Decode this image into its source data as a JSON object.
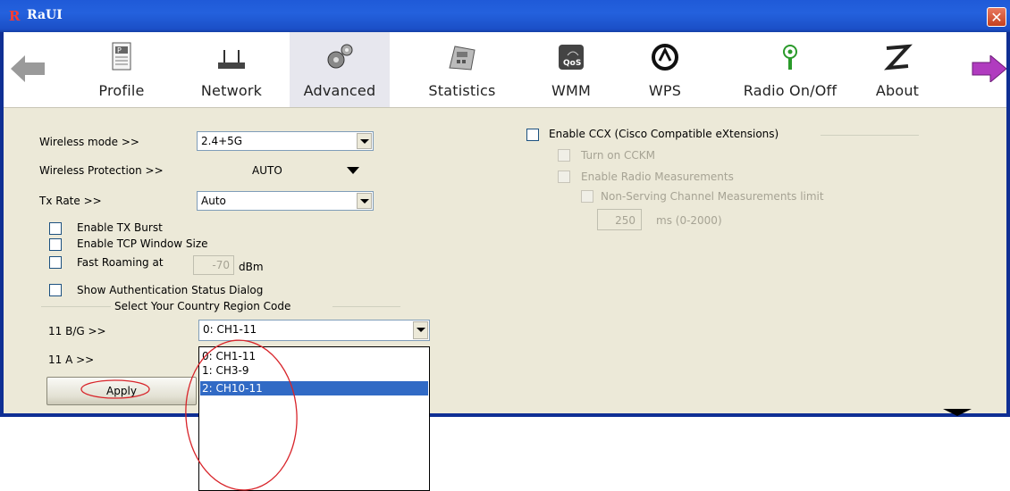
{
  "window": {
    "title": "RaUI",
    "logo": "R"
  },
  "toolbar": {
    "items": [
      {
        "label": "Profile",
        "icon": "profile-icon"
      },
      {
        "label": "Network",
        "icon": "network-icon"
      },
      {
        "label": "Advanced",
        "icon": "advanced-gears-icon"
      },
      {
        "label": "Statistics",
        "icon": "statistics-icon"
      },
      {
        "label": "WMM",
        "icon": "wmm-qos-icon"
      },
      {
        "label": "WPS",
        "icon": "wps-icon"
      },
      {
        "label": "Radio On/Off",
        "icon": "radio-antenna-icon"
      },
      {
        "label": "About",
        "icon": "about-icon"
      }
    ],
    "selected": "Advanced"
  },
  "settings": {
    "wireless_mode_label": "Wireless mode >>",
    "wireless_mode_value": "2.4+5G",
    "wireless_protection_label": "Wireless Protection >>",
    "wireless_protection_value": "AUTO",
    "tx_rate_label": "Tx Rate >>",
    "tx_rate_value": "Auto",
    "enable_tx_burst": "Enable TX Burst",
    "enable_tcp_window": "Enable TCP Window Size",
    "fast_roaming": "Fast Roaming at",
    "fast_roaming_value": "-70",
    "fast_roaming_unit": "dBm",
    "show_auth": "Show Authentication Status Dialog",
    "country_group": "Select Your Country Region Code",
    "bg_label": "11 B/G >>",
    "bg_value": "0: CH1-11",
    "a_label": "11 A >>",
    "apply": "Apply"
  },
  "ccx": {
    "enable": "Enable CCX (Cisco Compatible eXtensions)",
    "turn_on_cckm": "Turn on CCKM",
    "enable_radio_meas": "Enable Radio Measurements",
    "non_serving": "Non-Serving Channel Measurements limit",
    "limit_value": "250",
    "limit_unit": "ms (0-2000)"
  },
  "dropdown": {
    "options": [
      "0: CH1-11",
      "1: CH3-9",
      "2: CH10-11"
    ],
    "highlighted": 2
  },
  "colors": {
    "titlebar": "#2461dd",
    "selection": "#316ac5",
    "annotation": "#d8242a",
    "panel": "#ece9d8"
  }
}
